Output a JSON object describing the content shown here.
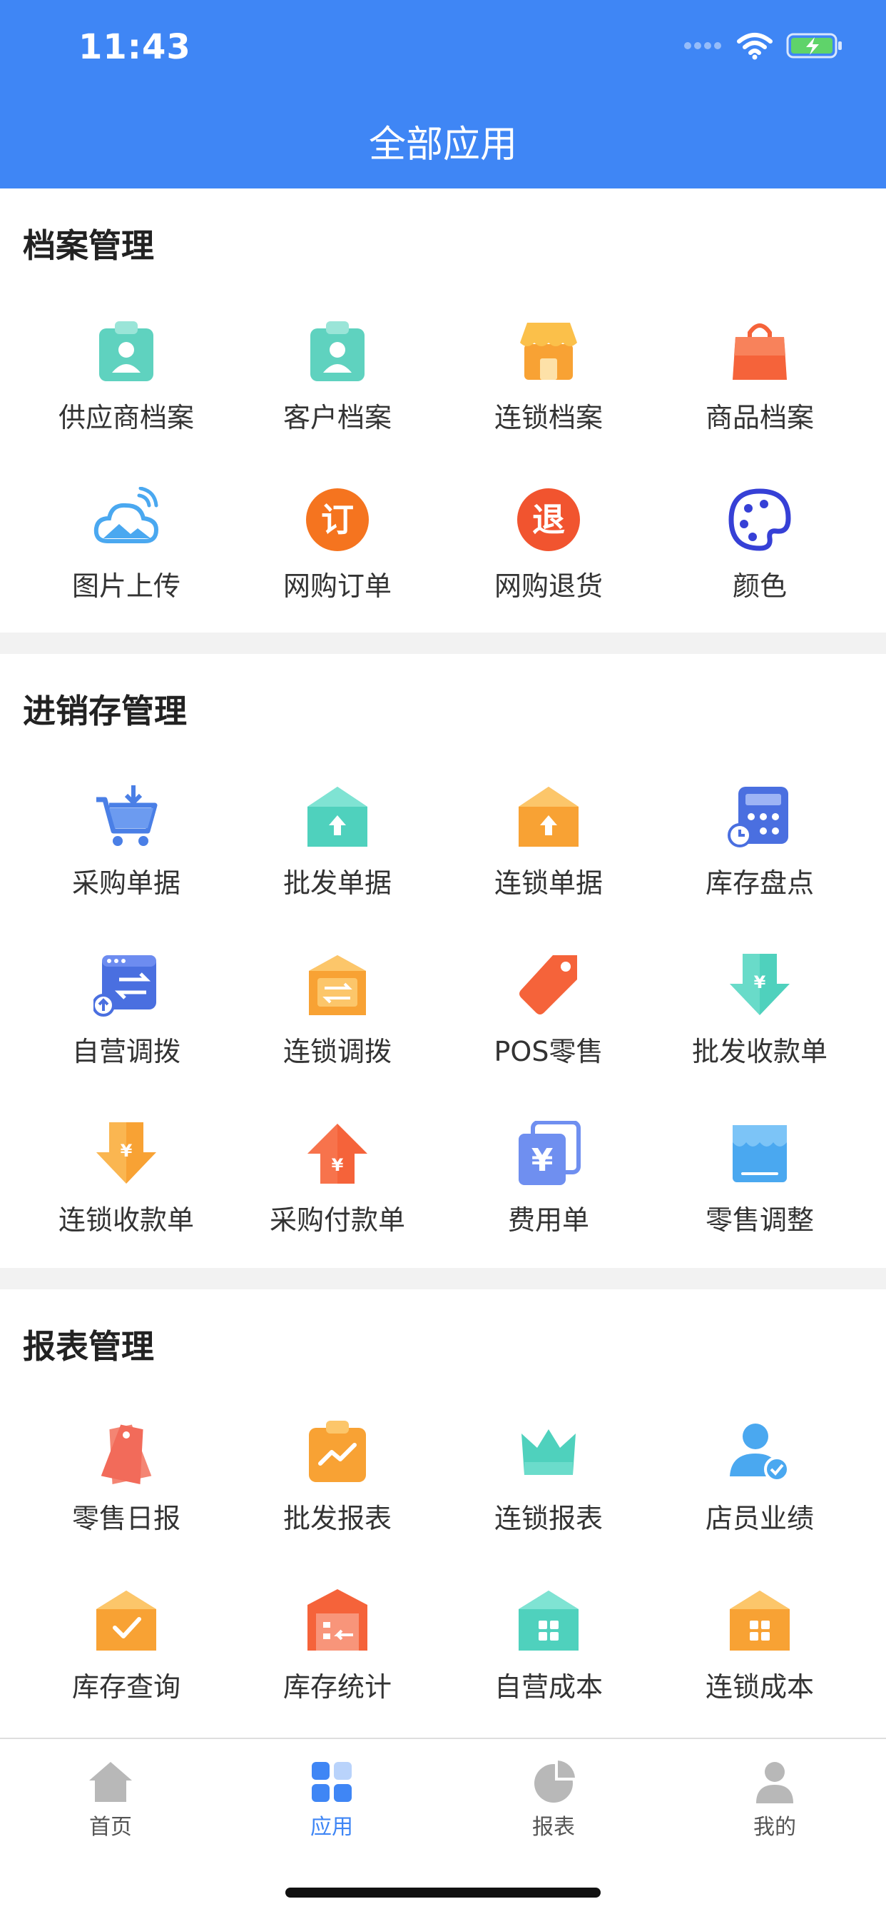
{
  "status_bar": {
    "time": "11:43"
  },
  "header": {
    "title": "全部应用"
  },
  "sections": [
    {
      "title": "档案管理",
      "items": [
        {
          "label": "供应商档案",
          "icon": "supplier-badge-icon"
        },
        {
          "label": "客户档案",
          "icon": "customer-badge-icon"
        },
        {
          "label": "连锁档案",
          "icon": "store-icon"
        },
        {
          "label": "商品档案",
          "icon": "shopping-bag-icon"
        },
        {
          "label": "图片上传",
          "icon": "cloud-upload-icon"
        },
        {
          "label": "网购订单",
          "icon": "ding-order-icon",
          "glyph": "订"
        },
        {
          "label": "网购退货",
          "icon": "tui-return-icon",
          "glyph": "退"
        },
        {
          "label": "颜色",
          "icon": "palette-icon"
        }
      ]
    },
    {
      "title": "进销存管理",
      "items": [
        {
          "label": "采购单据",
          "icon": "cart-icon"
        },
        {
          "label": "批发单据",
          "icon": "house-up-teal-icon"
        },
        {
          "label": "连锁单据",
          "icon": "house-up-orange-icon"
        },
        {
          "label": "库存盘点",
          "icon": "calculator-icon"
        },
        {
          "label": "自营调拨",
          "icon": "transfer-window-icon"
        },
        {
          "label": "连锁调拨",
          "icon": "transfer-box-icon"
        },
        {
          "label": "POS零售",
          "icon": "price-tag-icon"
        },
        {
          "label": "批发收款单",
          "icon": "arrow-down-yen-teal-icon",
          "glyph": "¥"
        },
        {
          "label": "连锁收款单",
          "icon": "arrow-down-yen-orange-icon",
          "glyph": "¥"
        },
        {
          "label": "采购付款单",
          "icon": "arrow-up-yen-red-icon",
          "glyph": "¥"
        },
        {
          "label": "费用单",
          "icon": "yen-cards-icon",
          "glyph": "¥"
        },
        {
          "label": "零售调整",
          "icon": "awning-icon"
        }
      ]
    },
    {
      "title": "报表管理",
      "items": [
        {
          "label": "零售日报",
          "icon": "tags-icon"
        },
        {
          "label": "批发报表",
          "icon": "clipboard-chart-icon"
        },
        {
          "label": "连锁报表",
          "icon": "crown-icon"
        },
        {
          "label": "店员业绩",
          "icon": "user-check-icon"
        },
        {
          "label": "库存查询",
          "icon": "house-check-icon"
        },
        {
          "label": "库存统计",
          "icon": "warehouse-icon"
        },
        {
          "label": "自营成本",
          "icon": "house-grid-teal-icon"
        },
        {
          "label": "连锁成本",
          "icon": "house-grid-orange-icon"
        }
      ]
    }
  ],
  "tabbar": {
    "active_color": "#3f86f5",
    "tabs": [
      {
        "label": "首页",
        "icon": "home-icon"
      },
      {
        "label": "应用",
        "icon": "apps-grid-icon",
        "active": true
      },
      {
        "label": "报表",
        "icon": "pie-chart-icon"
      },
      {
        "label": "我的",
        "icon": "user-icon"
      }
    ]
  },
  "colors": {
    "header_blue": "#3f86f5",
    "teal": "#4fd1bd",
    "orange": "#f8a234",
    "red": "#f5633a"
  }
}
